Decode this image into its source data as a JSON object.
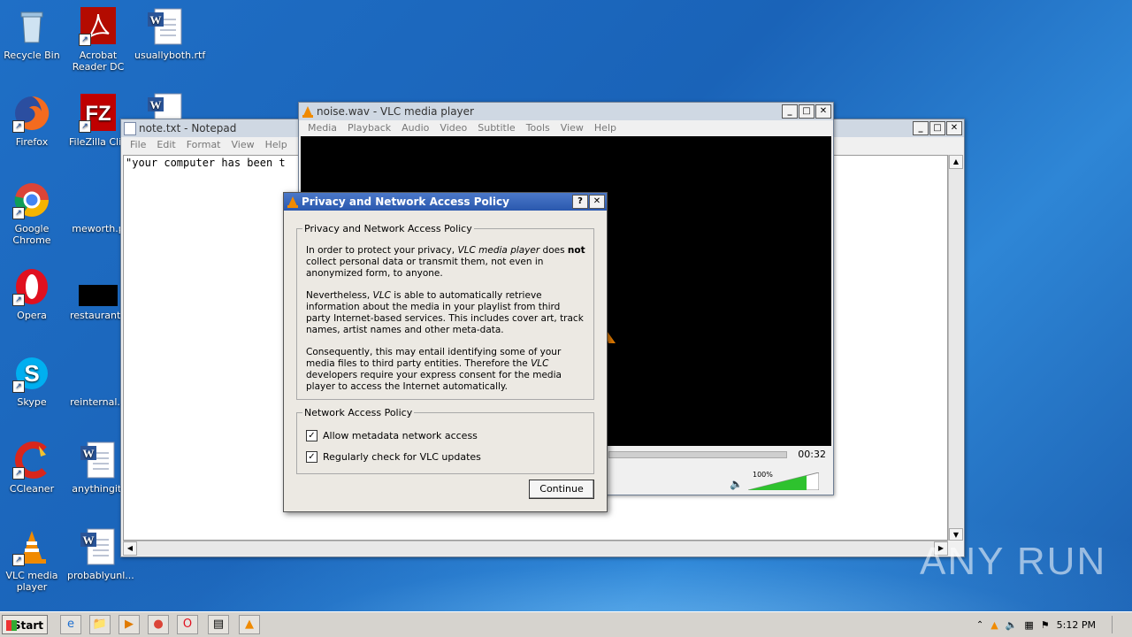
{
  "desktop": {
    "icons": [
      {
        "label": "Recycle Bin"
      },
      {
        "label": "Acrobat Reader DC"
      },
      {
        "label": "usuallyboth.rtf"
      },
      {
        "label": "Firefox"
      },
      {
        "label": "FileZilla Clie"
      },
      {
        "label": "Google Chrome"
      },
      {
        "label": "meworth.p"
      },
      {
        "label": "Opera"
      },
      {
        "label": "restauranto"
      },
      {
        "label": "Skype"
      },
      {
        "label": "reinternal.p"
      },
      {
        "label": "CCleaner"
      },
      {
        "label": "anythingit."
      },
      {
        "label": "VLC media player"
      },
      {
        "label": "probablyunl..."
      }
    ]
  },
  "notepad": {
    "title": "note.txt - Notepad",
    "menu": [
      "File",
      "Edit",
      "Format",
      "View",
      "Help"
    ],
    "content": "\"your computer has been t"
  },
  "vlc": {
    "title": "noise.wav - VLC media player",
    "menu": [
      "Media",
      "Playback",
      "Audio",
      "Video",
      "Subtitle",
      "Tools",
      "View",
      "Help"
    ],
    "time": "00:32",
    "volume_label": "100%",
    "volume": 1.0
  },
  "dialog": {
    "title": "Privacy and Network Access Policy",
    "help_btn": "?",
    "close_btn": "✕",
    "group1_legend": "Privacy and Network Access Policy",
    "p1_a": "In order to protect your privacy, ",
    "p1_em": "VLC media player",
    "p1_b": " does ",
    "p1_strong": "not",
    "p1_c": " collect personal data or transmit them, not even in anonymized form, to anyone.",
    "p2_a": "Nevertheless, ",
    "p2_em": "VLC",
    "p2_b": " is able to automatically retrieve information about the media in your playlist from third party Internet-based services. This includes cover art, track names, artist names and other meta-data.",
    "p3_a": "Consequently, this may entail identifying some of your media files to third party entities. Therefore the ",
    "p3_em": "VLC",
    "p3_b": " developers require your express consent for the media player to access the Internet automatically.",
    "group2_legend": "Network Access Policy",
    "check1": {
      "label": "Allow metadata network access",
      "checked": true
    },
    "check2": {
      "label": "Regularly check for VLC updates",
      "checked": true
    },
    "continue_label": "Continue"
  },
  "taskbar": {
    "start_label": "Start",
    "clock": "5:12 PM"
  },
  "watermark": "ANY RUN"
}
